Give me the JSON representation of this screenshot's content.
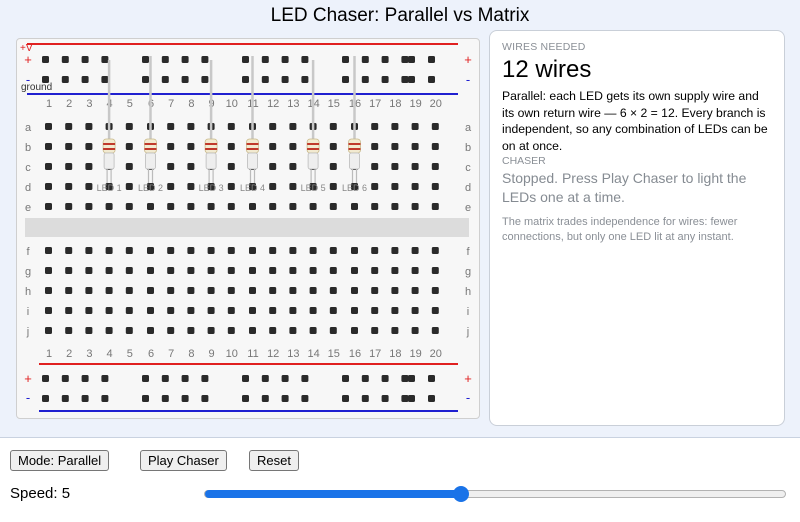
{
  "app": {
    "title": "LED Chaser: Parallel vs Matrix"
  },
  "breadboard": {
    "column_numbers": [
      "1",
      "2",
      "3",
      "4",
      "5",
      "6",
      "7",
      "8",
      "9",
      "10",
      "11",
      "12",
      "13",
      "14",
      "15",
      "16",
      "17",
      "18",
      "19",
      "20"
    ],
    "rows_top": [
      "a",
      "b",
      "c",
      "d",
      "e"
    ],
    "rows_bottom": [
      "f",
      "g",
      "h",
      "i",
      "j"
    ],
    "plus_label": "+",
    "minus_label": "-",
    "supply_label": "+V",
    "ground_label": "ground",
    "leds": [
      {
        "label": "LED 1",
        "column": 4
      },
      {
        "label": "LED 2",
        "column": 6
      },
      {
        "label": "LED 3",
        "column": 9
      },
      {
        "label": "LED 4",
        "column": 11
      },
      {
        "label": "LED 5",
        "column": 14
      },
      {
        "label": "LED 6",
        "column": 16
      }
    ],
    "colors": {
      "positive_rail": "#e02020",
      "negative_rail": "#2020d0",
      "hole": "#2a2a2a",
      "trench": "#dcdcdc",
      "wire": "#c8c8c8",
      "resistor_band": "#c0392b"
    }
  },
  "info_panel": {
    "wires_heading": "WIRES NEEDED",
    "wires_count": "12 wires",
    "description": "Parallel: each LED gets its own supply wire and its own return wire — 6 × 2 = 12. Every branch is independent, so any combination of LEDs can be on at once.",
    "chaser_heading": "CHASER",
    "chaser_status": "Stopped. Press Play Chaser to light the LEDs one at a time.",
    "note": "The matrix trades independence for wires: fewer connections, but only one LED lit at any instant."
  },
  "controls": {
    "mode_button": "Mode: Parallel",
    "play_button": "Play Chaser",
    "reset_button": "Reset",
    "speed_label": "Speed: 5",
    "speed_value": 5,
    "speed_fraction": 0.44,
    "accent": "#1a73e8"
  }
}
